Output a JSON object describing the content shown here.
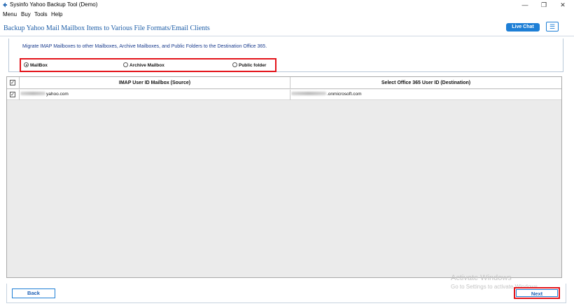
{
  "window": {
    "title": "Sysinfo Yahoo Backup Tool (Demo)",
    "controls": {
      "minimize": "—",
      "maximize": "❐",
      "close": "✕"
    }
  },
  "menu": {
    "items": [
      "Menu",
      "Buy",
      "Tools",
      "Help"
    ]
  },
  "header": {
    "title": "Backup Yahoo Mail Mailbox Items to Various File Formats/Email Clients",
    "live_chat": "Live Chat",
    "menu_icon": "☰"
  },
  "options": {
    "description": "Migrate IMAP Mailboxes to other Mailboxes, Archive Mailboxes, and Public Folders to the Destination Office 365.",
    "radios": [
      {
        "label": "MailBox",
        "checked": true
      },
      {
        "label": "Archive Mailbox",
        "checked": false
      },
      {
        "label": "Public folder",
        "checked": false
      }
    ]
  },
  "grid": {
    "columns": [
      "IMAP User ID Mailbox (Source)",
      "Select Office 365 User ID (Destination)"
    ],
    "header_checked": true,
    "rows": [
      {
        "checked": true,
        "source": "yahoo.com",
        "destination": ".onmicrosoft.com"
      }
    ]
  },
  "footer": {
    "back": "Back",
    "next": "Next"
  },
  "watermark": {
    "line1": "Activate Windows",
    "line2": "Go to Settings to activate Windows."
  },
  "colors": {
    "accent": "#1e7fd6",
    "title_blue": "#1f5fa8",
    "highlight_red": "#e3141a"
  }
}
